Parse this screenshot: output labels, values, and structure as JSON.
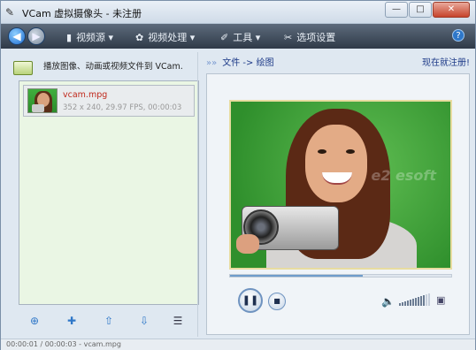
{
  "window": {
    "title": "VCam 虚拟摄像头 - 未注册",
    "minimize_label": "—",
    "maximize_label": "□",
    "close_label": "✕"
  },
  "toolbar": {
    "items": [
      {
        "label": "视频源 ▾"
      },
      {
        "label": "视频处理 ▾"
      },
      {
        "label": "工具 ▾"
      },
      {
        "label": "选项设置"
      }
    ],
    "help_label": "?"
  },
  "left": {
    "hint": "播放图像、动画或视频文件到 VCam.",
    "list": [
      {
        "name": "vcam.mpg",
        "meta": "352 x 240, 29.97 FPS, 00:00:03"
      }
    ]
  },
  "right": {
    "breadcrumb": "文件 -> 绘图",
    "register_link": "现在就注册!",
    "seek_progress": 0.6,
    "volume_level": 0.8
  },
  "status": {
    "text": "00:00:01 / 00:00:03 - vcam.mpg"
  }
}
